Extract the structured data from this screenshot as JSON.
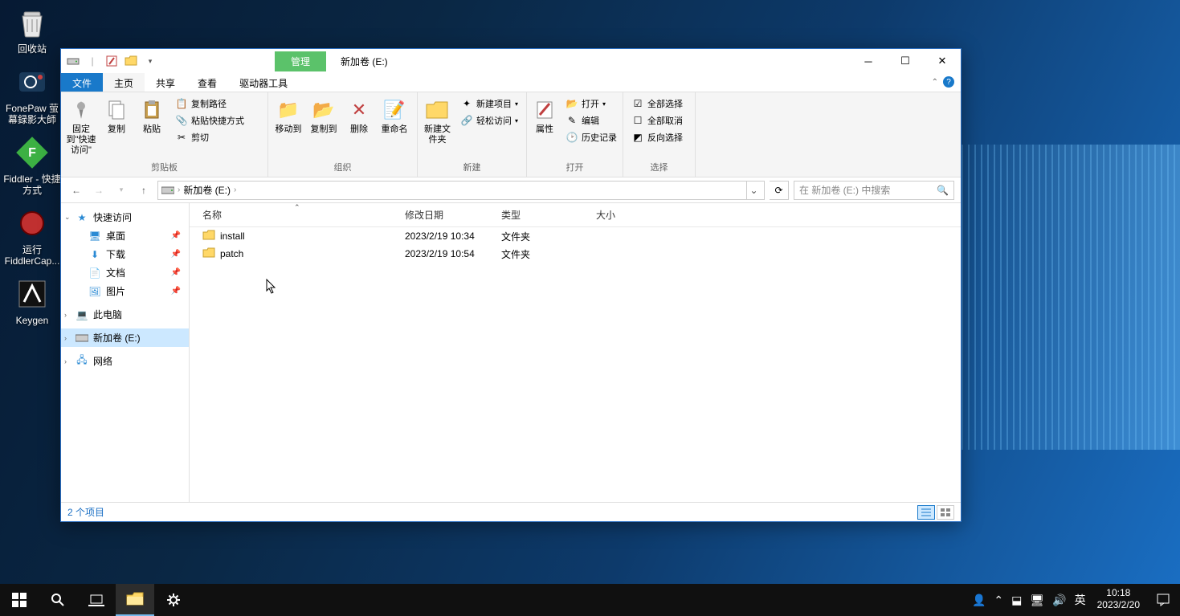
{
  "desktop": {
    "icons": [
      {
        "name": "回收站"
      },
      {
        "name": "FonePaw 萤幕録影大師"
      },
      {
        "name": "Fiddler - 快捷方式"
      },
      {
        "name": "运行FiddlerCap..."
      },
      {
        "name": "Keygen"
      }
    ]
  },
  "explorer": {
    "title": "新加卷 (E:)",
    "context_tab": "管理",
    "tabs": {
      "file": "文件",
      "home": "主页",
      "share": "共享",
      "view": "查看",
      "drive": "驱动器工具"
    },
    "ribbon": {
      "clipboard": {
        "pin": "固定到\"快速访问\"",
        "copy": "复制",
        "paste": "粘贴",
        "copypath": "复制路径",
        "pasteshortcut": "粘贴快捷方式",
        "cut": "剪切",
        "label": "剪贴板"
      },
      "organize": {
        "moveto": "移动到",
        "copyto": "复制到",
        "delete": "删除",
        "rename": "重命名",
        "label": "组织"
      },
      "new": {
        "newfolder": "新建文件夹",
        "newitem": "新建项目",
        "easyaccess": "轻松访问",
        "label": "新建"
      },
      "open": {
        "properties": "属性",
        "open": "打开",
        "edit": "编辑",
        "history": "历史记录",
        "label": "打开"
      },
      "select": {
        "selectall": "全部选择",
        "selectnone": "全部取消",
        "invert": "反向选择",
        "label": "选择"
      }
    },
    "address": {
      "location": "新加卷 (E:)"
    },
    "search": {
      "placeholder": "在 新加卷 (E:) 中搜索"
    },
    "nav": {
      "quickaccess": "快速访问",
      "desktop": "桌面",
      "downloads": "下载",
      "documents": "文档",
      "pictures": "图片",
      "thispc": "此电脑",
      "drive_e": "新加卷 (E:)",
      "network": "网络"
    },
    "columns": {
      "name": "名称",
      "date": "修改日期",
      "type": "类型",
      "size": "大小"
    },
    "files": [
      {
        "name": "install",
        "date": "2023/2/19 10:34",
        "type": "文件夹",
        "size": ""
      },
      {
        "name": "patch",
        "date": "2023/2/19 10:54",
        "type": "文件夹",
        "size": ""
      }
    ],
    "status": "2 个项目"
  },
  "taskbar": {
    "ime": "英",
    "time": "10:18",
    "date": "2023/2/20"
  }
}
